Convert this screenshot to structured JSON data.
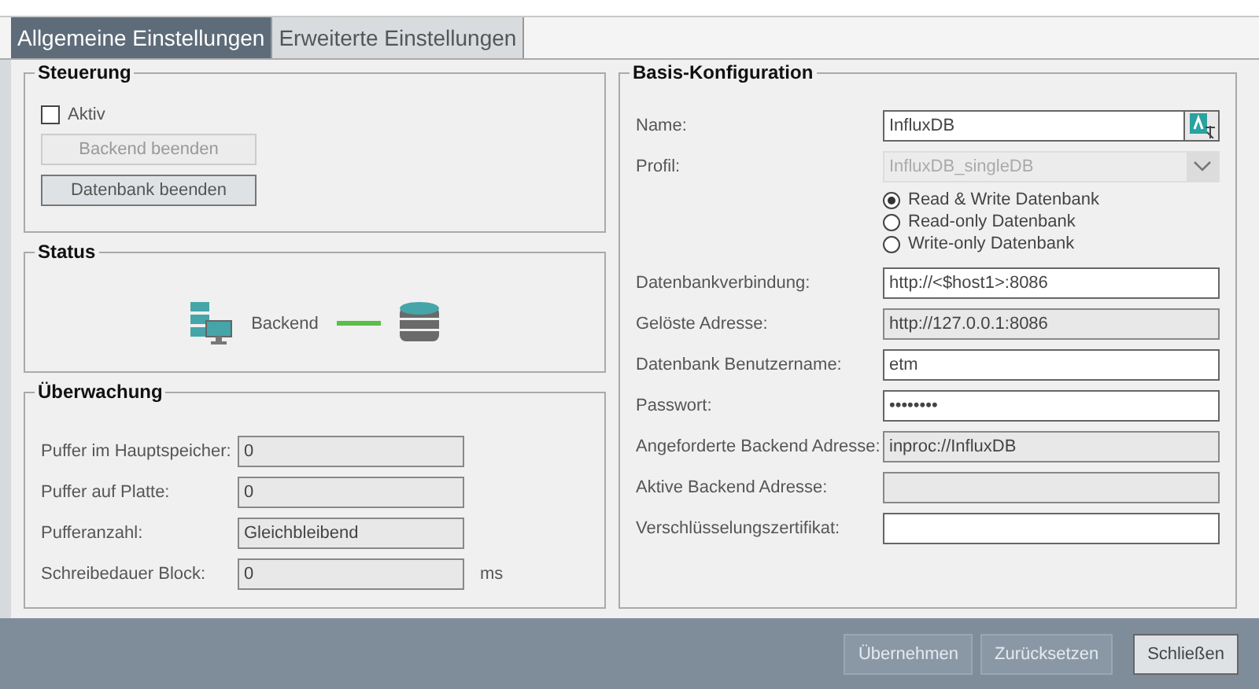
{
  "tabs": [
    {
      "label": "Allgemeine Einstellungen",
      "selected": true
    },
    {
      "label": "Erweiterte Einstellungen",
      "selected": false
    }
  ],
  "steuerung": {
    "title": "Steuerung",
    "checkbox": {
      "label": "Aktiv",
      "checked": false
    },
    "buttons": [
      {
        "label": "Backend beenden",
        "disabled": true
      },
      {
        "label": "Datenbank beenden",
        "disabled": false
      }
    ]
  },
  "status": {
    "title": "Status",
    "label": "Backend",
    "connected": true
  },
  "ueberwachung": {
    "title": "Überwachung",
    "rows": [
      {
        "label": "Puffer im Hauptspeicher:",
        "value": "0"
      },
      {
        "label": "Puffer auf Platte:",
        "value": "0"
      },
      {
        "label": "Pufferanzahl:",
        "value": "Gleichbleibend"
      },
      {
        "label": "Schreibedauer Block:",
        "value": "0",
        "unit": "ms"
      }
    ]
  },
  "basis": {
    "title": "Basis-Konfiguration",
    "rows": [
      {
        "kind": "name",
        "label": "Name:",
        "value": "InfluxDB"
      },
      {
        "kind": "dropdown",
        "label": "Profil:",
        "value": "InfluxDB_singleDB",
        "disabled": true
      },
      {
        "kind": "radios",
        "options": [
          {
            "label": "Read & Write Datenbank",
            "selected": true
          },
          {
            "label": "Read-only Datenbank",
            "selected": false
          },
          {
            "label": "Write-only Datenbank",
            "selected": false
          }
        ]
      },
      {
        "kind": "text",
        "label": "Datenbankverbindung:",
        "value": "http://<$host1>:8086",
        "readonly": false
      },
      {
        "kind": "text",
        "label": "Gelöste Adresse:",
        "value": "http://127.0.0.1:8086",
        "readonly": true
      },
      {
        "kind": "text",
        "label": "Datenbank Benutzername:",
        "value": "etm",
        "readonly": false
      },
      {
        "kind": "text",
        "label": "Passwort:",
        "value": "••••••••",
        "readonly": false
      },
      {
        "kind": "text",
        "label": "Angeforderte Backend Adresse:",
        "value": "inproc://InfluxDB",
        "readonly": true
      },
      {
        "kind": "text",
        "label": "Aktive Backend Adresse:",
        "readonly": true
      },
      {
        "kind": "text",
        "label": "Verschlüsselungszertifikat:",
        "readonly": false
      }
    ]
  },
  "footer": [
    {
      "label": "Übernehmen",
      "disabled": true
    },
    {
      "label": "Zurücksetzen",
      "disabled": true
    },
    {
      "label": "Schließen",
      "disabled": false
    }
  ]
}
